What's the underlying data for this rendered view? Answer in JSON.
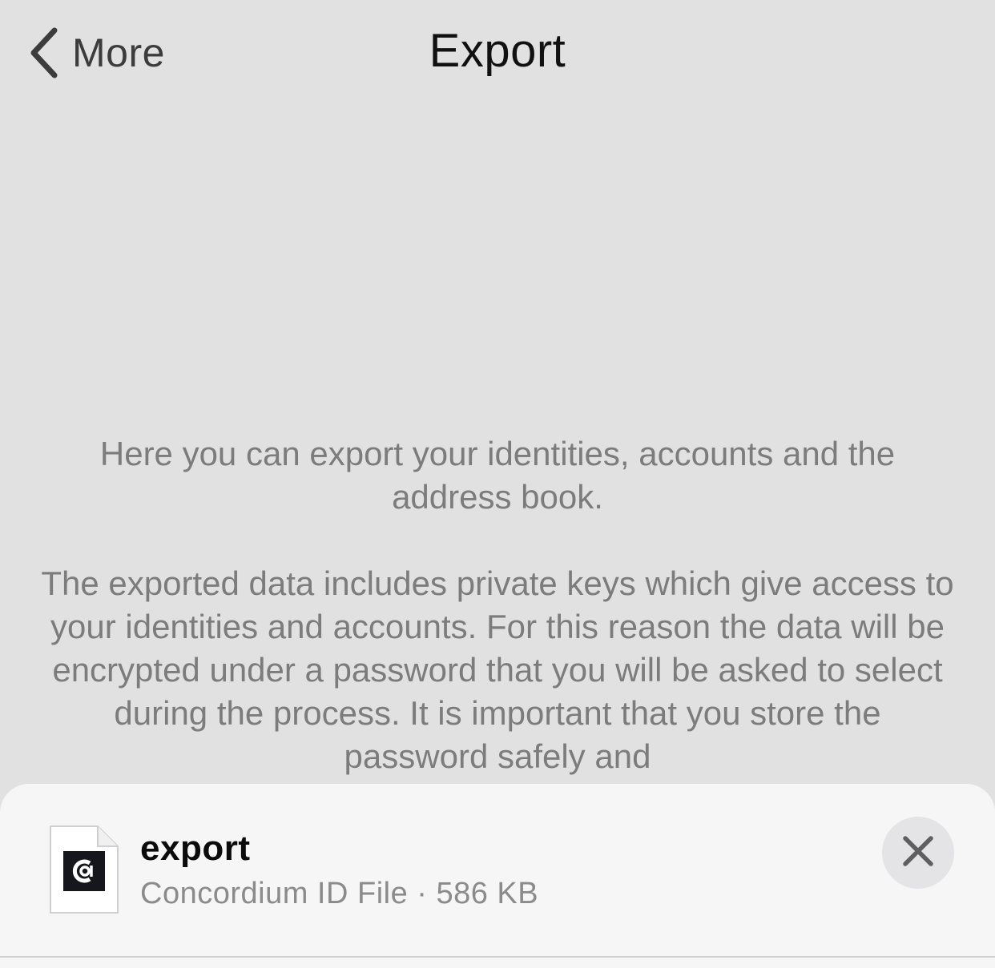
{
  "nav": {
    "back_label": "More",
    "back_icon": "chevron-left-icon",
    "title": "Export"
  },
  "content": {
    "paragraph1": "Here you can export your identities, accounts and the address book.",
    "paragraph2": "The exported data includes private keys which give access to your identities and accounts. For this reason the data will be encrypted under a password that you will be asked to select during the process. It is important that you store the password safely and"
  },
  "share_sheet": {
    "file_name": "export",
    "file_meta": "Concordium ID File · 586 KB",
    "file_icon": "concordium-file-icon",
    "close_icon": "close-icon"
  },
  "colors": {
    "background": "#e1e1e1",
    "sheet": "#f6f6f6",
    "body_text": "#7c7c7c"
  }
}
